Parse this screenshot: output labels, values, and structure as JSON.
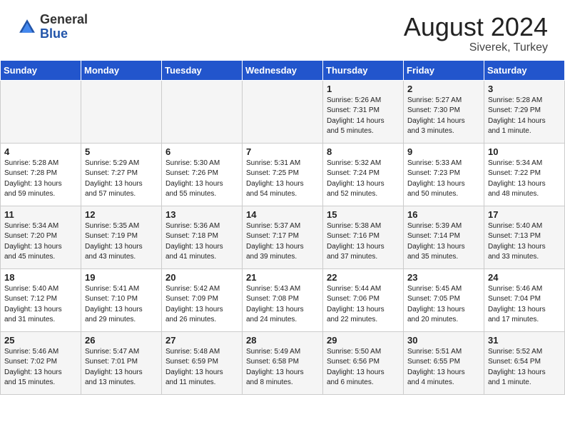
{
  "header": {
    "logo_general": "General",
    "logo_blue": "Blue",
    "month_year": "August 2024",
    "location": "Siverek, Turkey"
  },
  "days_of_week": [
    "Sunday",
    "Monday",
    "Tuesday",
    "Wednesday",
    "Thursday",
    "Friday",
    "Saturday"
  ],
  "weeks": [
    [
      {
        "day": "",
        "info": ""
      },
      {
        "day": "",
        "info": ""
      },
      {
        "day": "",
        "info": ""
      },
      {
        "day": "",
        "info": ""
      },
      {
        "day": "1",
        "info": "Sunrise: 5:26 AM\nSunset: 7:31 PM\nDaylight: 14 hours\nand 5 minutes."
      },
      {
        "day": "2",
        "info": "Sunrise: 5:27 AM\nSunset: 7:30 PM\nDaylight: 14 hours\nand 3 minutes."
      },
      {
        "day": "3",
        "info": "Sunrise: 5:28 AM\nSunset: 7:29 PM\nDaylight: 14 hours\nand 1 minute."
      }
    ],
    [
      {
        "day": "4",
        "info": "Sunrise: 5:28 AM\nSunset: 7:28 PM\nDaylight: 13 hours\nand 59 minutes."
      },
      {
        "day": "5",
        "info": "Sunrise: 5:29 AM\nSunset: 7:27 PM\nDaylight: 13 hours\nand 57 minutes."
      },
      {
        "day": "6",
        "info": "Sunrise: 5:30 AM\nSunset: 7:26 PM\nDaylight: 13 hours\nand 55 minutes."
      },
      {
        "day": "7",
        "info": "Sunrise: 5:31 AM\nSunset: 7:25 PM\nDaylight: 13 hours\nand 54 minutes."
      },
      {
        "day": "8",
        "info": "Sunrise: 5:32 AM\nSunset: 7:24 PM\nDaylight: 13 hours\nand 52 minutes."
      },
      {
        "day": "9",
        "info": "Sunrise: 5:33 AM\nSunset: 7:23 PM\nDaylight: 13 hours\nand 50 minutes."
      },
      {
        "day": "10",
        "info": "Sunrise: 5:34 AM\nSunset: 7:22 PM\nDaylight: 13 hours\nand 48 minutes."
      }
    ],
    [
      {
        "day": "11",
        "info": "Sunrise: 5:34 AM\nSunset: 7:20 PM\nDaylight: 13 hours\nand 45 minutes."
      },
      {
        "day": "12",
        "info": "Sunrise: 5:35 AM\nSunset: 7:19 PM\nDaylight: 13 hours\nand 43 minutes."
      },
      {
        "day": "13",
        "info": "Sunrise: 5:36 AM\nSunset: 7:18 PM\nDaylight: 13 hours\nand 41 minutes."
      },
      {
        "day": "14",
        "info": "Sunrise: 5:37 AM\nSunset: 7:17 PM\nDaylight: 13 hours\nand 39 minutes."
      },
      {
        "day": "15",
        "info": "Sunrise: 5:38 AM\nSunset: 7:16 PM\nDaylight: 13 hours\nand 37 minutes."
      },
      {
        "day": "16",
        "info": "Sunrise: 5:39 AM\nSunset: 7:14 PM\nDaylight: 13 hours\nand 35 minutes."
      },
      {
        "day": "17",
        "info": "Sunrise: 5:40 AM\nSunset: 7:13 PM\nDaylight: 13 hours\nand 33 minutes."
      }
    ],
    [
      {
        "day": "18",
        "info": "Sunrise: 5:40 AM\nSunset: 7:12 PM\nDaylight: 13 hours\nand 31 minutes."
      },
      {
        "day": "19",
        "info": "Sunrise: 5:41 AM\nSunset: 7:10 PM\nDaylight: 13 hours\nand 29 minutes."
      },
      {
        "day": "20",
        "info": "Sunrise: 5:42 AM\nSunset: 7:09 PM\nDaylight: 13 hours\nand 26 minutes."
      },
      {
        "day": "21",
        "info": "Sunrise: 5:43 AM\nSunset: 7:08 PM\nDaylight: 13 hours\nand 24 minutes."
      },
      {
        "day": "22",
        "info": "Sunrise: 5:44 AM\nSunset: 7:06 PM\nDaylight: 13 hours\nand 22 minutes."
      },
      {
        "day": "23",
        "info": "Sunrise: 5:45 AM\nSunset: 7:05 PM\nDaylight: 13 hours\nand 20 minutes."
      },
      {
        "day": "24",
        "info": "Sunrise: 5:46 AM\nSunset: 7:04 PM\nDaylight: 13 hours\nand 17 minutes."
      }
    ],
    [
      {
        "day": "25",
        "info": "Sunrise: 5:46 AM\nSunset: 7:02 PM\nDaylight: 13 hours\nand 15 minutes."
      },
      {
        "day": "26",
        "info": "Sunrise: 5:47 AM\nSunset: 7:01 PM\nDaylight: 13 hours\nand 13 minutes."
      },
      {
        "day": "27",
        "info": "Sunrise: 5:48 AM\nSunset: 6:59 PM\nDaylight: 13 hours\nand 11 minutes."
      },
      {
        "day": "28",
        "info": "Sunrise: 5:49 AM\nSunset: 6:58 PM\nDaylight: 13 hours\nand 8 minutes."
      },
      {
        "day": "29",
        "info": "Sunrise: 5:50 AM\nSunset: 6:56 PM\nDaylight: 13 hours\nand 6 minutes."
      },
      {
        "day": "30",
        "info": "Sunrise: 5:51 AM\nSunset: 6:55 PM\nDaylight: 13 hours\nand 4 minutes."
      },
      {
        "day": "31",
        "info": "Sunrise: 5:52 AM\nSunset: 6:54 PM\nDaylight: 13 hours\nand 1 minute."
      }
    ]
  ]
}
